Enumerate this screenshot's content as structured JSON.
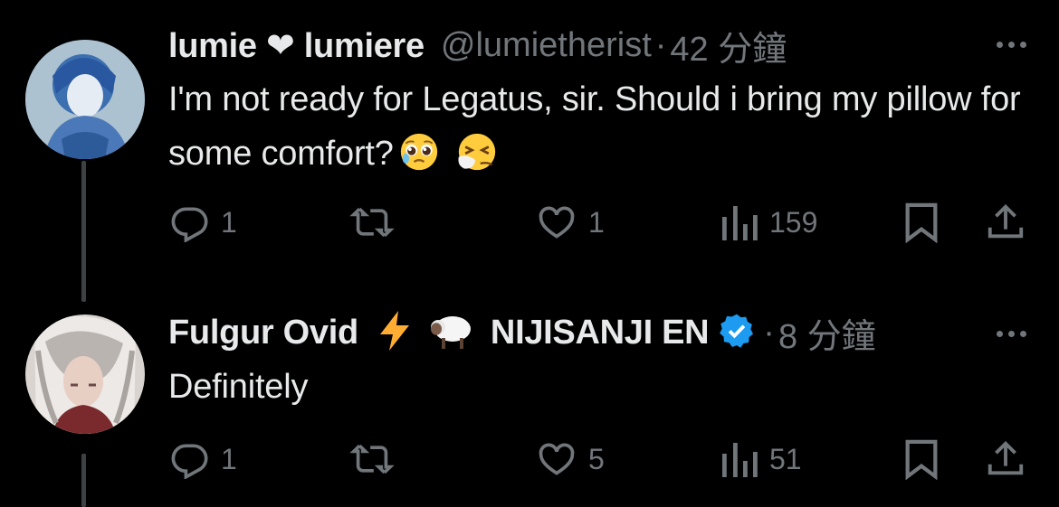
{
  "tweets": [
    {
      "author_name": "lumie ❤ lumiere",
      "handle": "@lumietherist",
      "separator": "·",
      "time": "42 分鐘",
      "text": "I'm not ready for Legatus, sir. Should i bring my pillow for some comfort?",
      "text_emojis": [
        "pleading-face",
        "sneezing-face"
      ],
      "replies": "1",
      "retweets": "",
      "likes": "1",
      "views": "159"
    },
    {
      "author_name_part1": "Fulgur Ovid",
      "author_name_emojis": [
        "⚡",
        "🐑"
      ],
      "author_name_part2": "NIJISANJI EN",
      "verified": true,
      "separator": "·",
      "time": "8 分鐘",
      "text": "Definitely",
      "replies": "1",
      "retweets": "",
      "likes": "5",
      "views": "51"
    }
  ],
  "colors": {
    "background": "#000000",
    "text": "#e7e9ea",
    "muted": "#71767b",
    "verified": "#1d9bf0",
    "thread_line": "#3e4144"
  },
  "icons": [
    "reply-icon",
    "retweet-icon",
    "like-icon",
    "views-icon",
    "bookmark-icon",
    "share-icon",
    "more-icon",
    "verified-badge-icon"
  ]
}
